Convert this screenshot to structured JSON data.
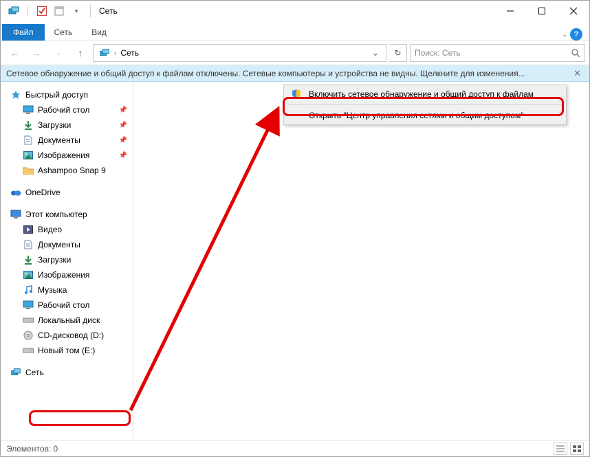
{
  "titlebar": {
    "title": "Сеть"
  },
  "ribbon": {
    "file": "Файл",
    "tabs": [
      "Сеть",
      "Вид"
    ]
  },
  "address": {
    "path": "Сеть",
    "search_placeholder": "Поиск: Сеть"
  },
  "infobar": {
    "text": "Сетевое обнаружение и общий доступ к файлам отключены. Сетевые компьютеры и устройства не видны. Щелкните для изменения..."
  },
  "tree": {
    "quick_access": "Быстрый доступ",
    "quick_items": [
      {
        "label": "Рабочий стол",
        "pinned": true,
        "icon": "desktop"
      },
      {
        "label": "Загрузки",
        "pinned": true,
        "icon": "downloads"
      },
      {
        "label": "Документы",
        "pinned": true,
        "icon": "documents"
      },
      {
        "label": "Изображения",
        "pinned": true,
        "icon": "pictures"
      },
      {
        "label": "Ashampoo Snap 9",
        "pinned": false,
        "icon": "folder"
      }
    ],
    "onedrive": "OneDrive",
    "this_pc": "Этот компьютер",
    "pc_items": [
      {
        "label": "Видео",
        "icon": "video"
      },
      {
        "label": "Документы",
        "icon": "documents"
      },
      {
        "label": "Загрузки",
        "icon": "downloads"
      },
      {
        "label": "Изображения",
        "icon": "pictures"
      },
      {
        "label": "Музыка",
        "icon": "music"
      },
      {
        "label": "Рабочий стол",
        "icon": "desktop"
      },
      {
        "label": "Локальный диск",
        "icon": "drive"
      },
      {
        "label": "CD-дисковод (D:)",
        "icon": "cd"
      },
      {
        "label": "Новый том (E:)",
        "icon": "drive"
      }
    ],
    "network": "Сеть"
  },
  "context_menu": {
    "items": [
      {
        "label": "Включить сетевое обнаружение и общий доступ к файлам",
        "shield": true
      },
      {
        "label": "Открыть \"Центр управления сетями и общим доступом\"",
        "shield": false
      }
    ]
  },
  "statusbar": {
    "count_label": "Элементов: 0"
  }
}
